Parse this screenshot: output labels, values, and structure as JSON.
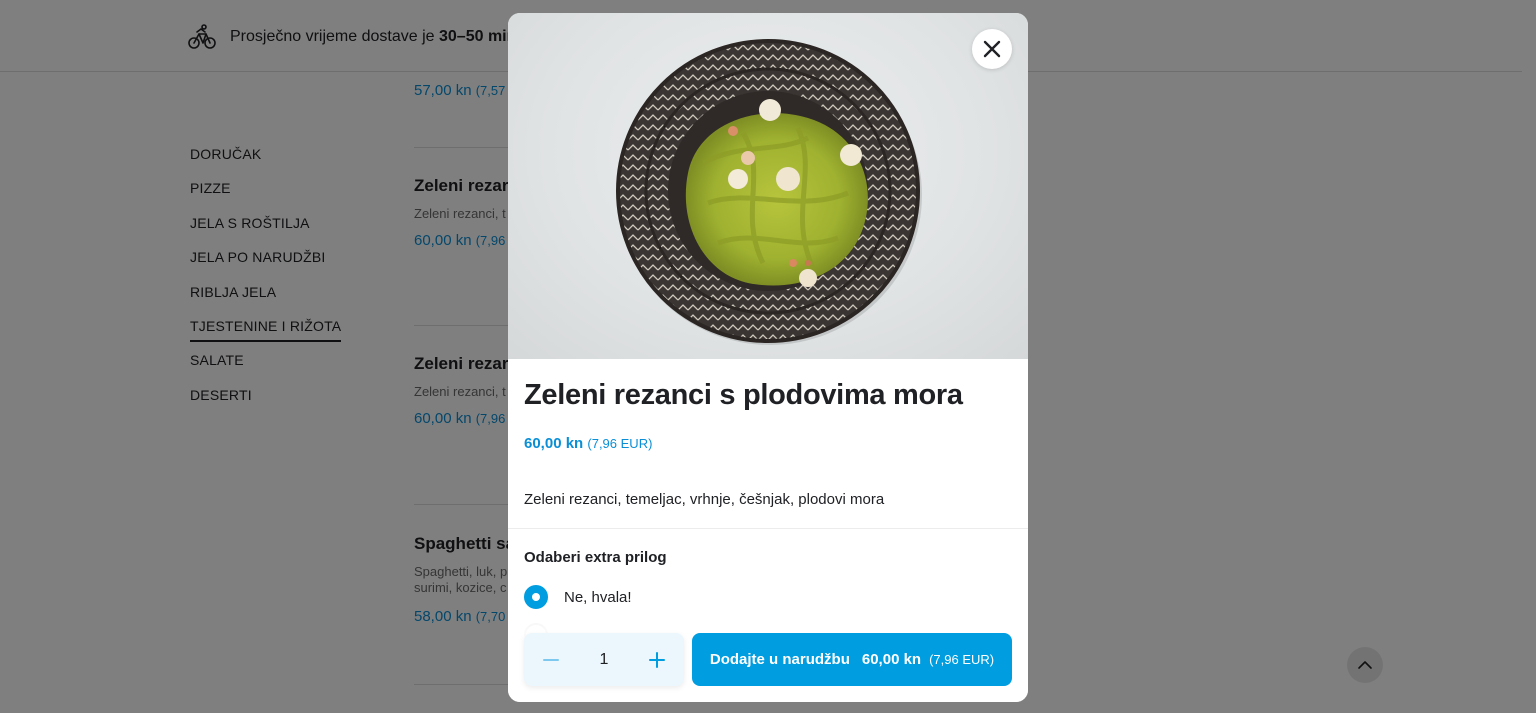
{
  "header": {
    "delivery_prefix": "Prosječno vrijeme dostave je",
    "delivery_time": "30–50 min"
  },
  "categories": [
    {
      "label": "DORUČAK",
      "active": false
    },
    {
      "label": "PIZZE",
      "active": false
    },
    {
      "label": "JELA S ROŠTILJA",
      "active": false
    },
    {
      "label": "JELA PO NARUDŽBI",
      "active": false
    },
    {
      "label": "RIBLJA JELA",
      "active": false
    },
    {
      "label": "TJESTENINE I RIŽOTA",
      "active": true
    },
    {
      "label": "SALATE",
      "active": false
    },
    {
      "label": "DESERTI",
      "active": false
    }
  ],
  "menu_items": [
    {
      "title": "",
      "desc": "",
      "price": "57,00 kn",
      "price_eur": "(7,57"
    },
    {
      "title": "Zeleni rezar",
      "desc": "Zeleni rezanci, t",
      "price": "60,00 kn",
      "price_eur": "(7,96"
    },
    {
      "title": "Zeleni rezar",
      "desc": "Zeleni rezanci, t",
      "price": "60,00 kn",
      "price_eur": "(7,96"
    },
    {
      "title": "Spaghetti sa",
      "desc": "Spaghetti, luk, p",
      "desc2": "surimi, kozice, c",
      "price": "58,00 kn",
      "price_eur": "(7,70"
    }
  ],
  "modal": {
    "title": "Zeleni rezanci s plodovima mora",
    "price": "60,00 kn",
    "price_eur": "(7,96 EUR)",
    "description": "Zeleni rezanci, temeljac, vrhnje, češnjak, plodovi mora",
    "option_group_title": "Odaberi extra prilog",
    "options": [
      {
        "label": "Ne, hvala!",
        "selected": true
      }
    ],
    "quantity": "1",
    "add_button": {
      "label": "Dodajte u narudžbu",
      "price": "60,00 kn",
      "price_eur": "(7,96 EUR)"
    }
  },
  "icons": {
    "delivery": "bicycle-courier-icon",
    "close": "close-icon",
    "minus": "minus-icon",
    "plus": "plus-icon",
    "scroll_top": "chevron-up-icon"
  },
  "colors": {
    "accent": "#009de0",
    "price": "#0a8fd6",
    "overlay": "rgba(0,0,0,0.5)"
  }
}
